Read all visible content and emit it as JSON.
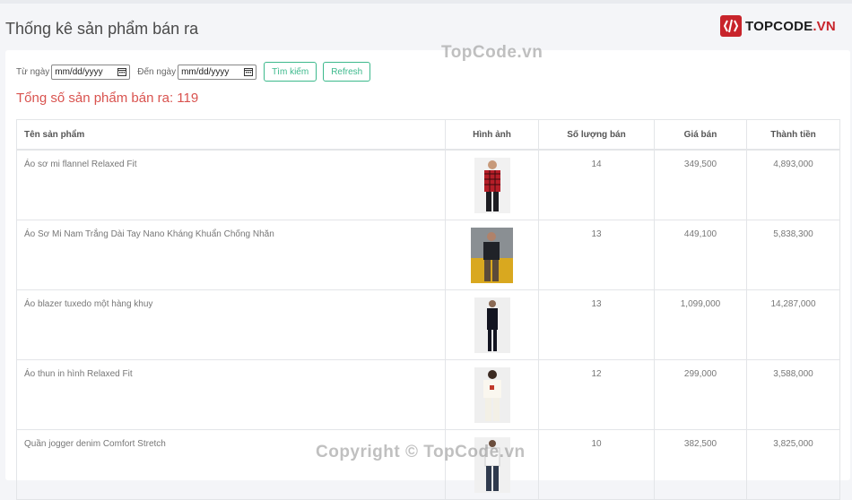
{
  "header": {
    "title": "Thống kê sản phẩm bán ra"
  },
  "logo": {
    "text_main": "TOPCODE",
    "text_suffix": ".VN"
  },
  "filter": {
    "from_label": "Từ ngày",
    "from_placeholder": "mm/dd/yyyy",
    "to_label": "Đến ngày",
    "to_placeholder": "mm/dd/yyyy",
    "search_label": "Tìm kiếm",
    "refresh_label": "Refresh"
  },
  "summary": {
    "total_text": "Tổng số sản phẩm bán ra: 119"
  },
  "table": {
    "columns": [
      "Tên sản phẩm",
      "Hình ảnh",
      "Số lượng bán",
      "Giá bán",
      "Thành tiền"
    ],
    "rows": [
      {
        "name": "Áo sơ mi flannel Relaxed Fit",
        "qty": "14",
        "price": "349,500",
        "total": "4,893,000",
        "image": "red-plaid-shirt"
      },
      {
        "name": "Áo Sơ Mi Nam Trắng Dài Tay Nano Kháng Khuẩn Chống Nhăn",
        "qty": "13",
        "price": "449,100",
        "total": "5,838,300",
        "image": "dark-shirt-khaki"
      },
      {
        "name": "Áo blazer tuxedo một hàng khuy",
        "qty": "13",
        "price": "1,099,000",
        "total": "14,287,000",
        "image": "black-tuxedo"
      },
      {
        "name": "Áo thun in hình Relaxed Fit",
        "qty": "12",
        "price": "299,000",
        "total": "3,588,000",
        "image": "white-tshirt"
      },
      {
        "name": "Quần jogger denim Comfort Stretch",
        "qty": "10",
        "price": "382,500",
        "total": "3,825,000",
        "image": "denim-jogger"
      }
    ]
  },
  "watermarks": {
    "top": "TopCode.vn",
    "bottom": "Copyright © TopCode.vn"
  },
  "colors": {
    "accent_green": "#3cb98c",
    "total_red": "#d9534f",
    "logo_red": "#c8242b"
  }
}
